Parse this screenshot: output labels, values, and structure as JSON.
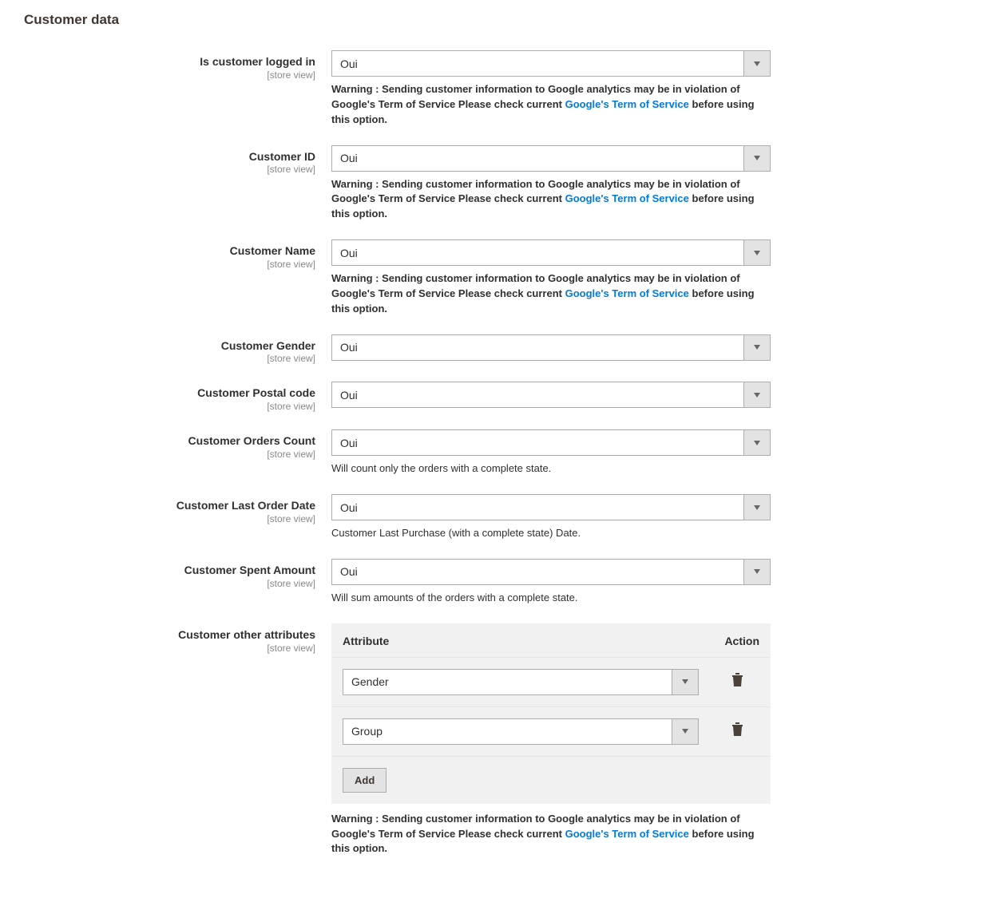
{
  "section_title": "Customer data",
  "scope_label": "[store view]",
  "warning": {
    "pre": "Warning : Sending customer information to Google analytics may be in violation of Google's Term of Service Please check current ",
    "link_text": "Google's Term of Service",
    "post": " before using this option."
  },
  "fields": {
    "is_logged_in": {
      "label": "Is customer logged in",
      "value": "Oui",
      "has_warning": true
    },
    "customer_id": {
      "label": "Customer ID",
      "value": "Oui",
      "has_warning": true
    },
    "customer_name": {
      "label": "Customer Name",
      "value": "Oui",
      "has_warning": true
    },
    "customer_gender": {
      "label": "Customer Gender",
      "value": "Oui"
    },
    "customer_postal": {
      "label": "Customer Postal code",
      "value": "Oui"
    },
    "customer_orders_count": {
      "label": "Customer Orders Count",
      "value": "Oui",
      "help": "Will count only the orders with a complete state."
    },
    "customer_last_order": {
      "label": "Customer Last Order Date",
      "value": "Oui",
      "help": "Customer Last Purchase (with a complete state) Date."
    },
    "customer_spent": {
      "label": "Customer Spent Amount",
      "value": "Oui",
      "help": "Will sum amounts of the orders with a complete state."
    }
  },
  "other_attributes": {
    "label": "Customer other attributes",
    "header_attribute": "Attribute",
    "header_action": "Action",
    "rows": [
      {
        "value": "Gender"
      },
      {
        "value": "Group"
      }
    ],
    "add_label": "Add"
  }
}
